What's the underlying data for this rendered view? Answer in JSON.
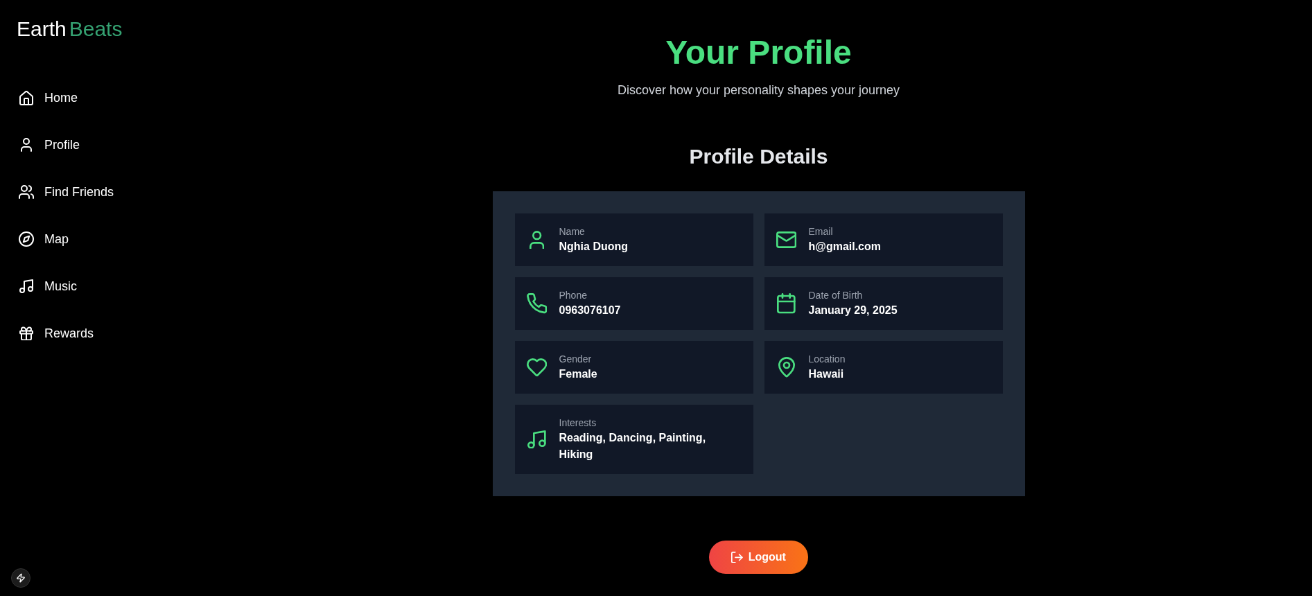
{
  "logo": {
    "brand": "Earth",
    "accent": "Beats"
  },
  "sidebar": {
    "items": [
      "Home",
      "Profile",
      "Find Friends",
      "Map",
      "Music",
      "Rewards"
    ]
  },
  "header": {
    "title": "Your Profile",
    "subtitle": "Discover how your personality shapes your journey"
  },
  "details": {
    "heading": "Profile Details",
    "fields": [
      {
        "label": "Name",
        "value": "Nghia Duong"
      },
      {
        "label": "Email",
        "value": "h@gmail.com"
      },
      {
        "label": "Phone",
        "value": "0963076107"
      },
      {
        "label": "Date of Birth",
        "value": "January 29, 2025"
      },
      {
        "label": "Gender",
        "value": "Female"
      },
      {
        "label": "Location",
        "value": "Hawaii"
      },
      {
        "label": "Interests",
        "value": "Reading, Dancing, Painting, Hiking"
      }
    ]
  },
  "logout_button": {
    "label": "Logout"
  }
}
